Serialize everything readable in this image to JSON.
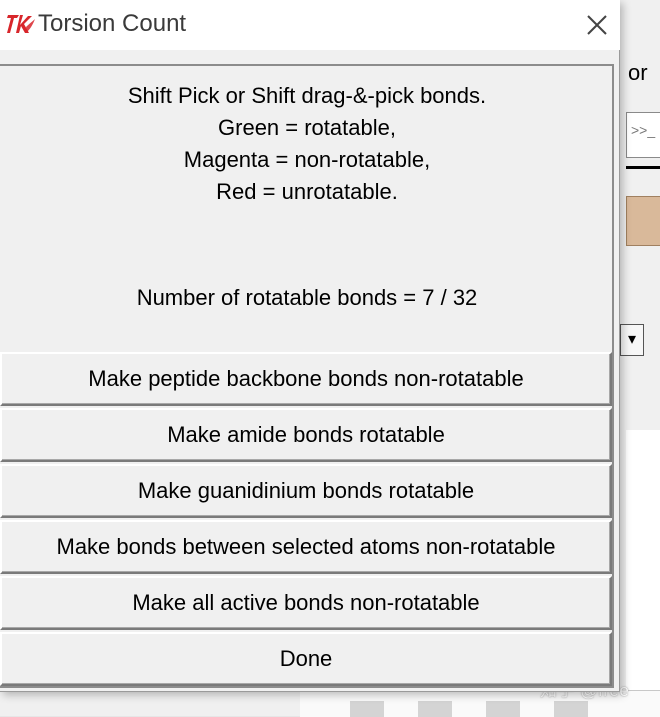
{
  "dialog": {
    "title": "Torsion Count",
    "instructions": [
      "Shift Pick or Shift drag-&-pick bonds.",
      "Green = rotatable,",
      "Magenta = non-rotatable,",
      "Red = unrotatable."
    ],
    "count_label": "Number of rotatable bonds = 7 / 32",
    "buttons": [
      "Make peptide backbone bonds non-rotatable",
      "Make amide bonds rotatable",
      "Make guanidinium bonds rotatable",
      "Make bonds between selected atoms non-rotatable",
      "Make all active bonds non-rotatable",
      "Done"
    ]
  },
  "background": {
    "menu_fragment": "or",
    "watermark": "知乎 @free"
  },
  "icons": {
    "app_icon": "tk-feather-icon",
    "close": "close-icon",
    "dropdown": "chevron-down-icon"
  },
  "colors": {
    "tk_icon_red": "#d8262b",
    "dialog_bg": "#f0f0f0",
    "titlebar_bg": "#ffffff",
    "tan_panel": "#d9b99a"
  }
}
